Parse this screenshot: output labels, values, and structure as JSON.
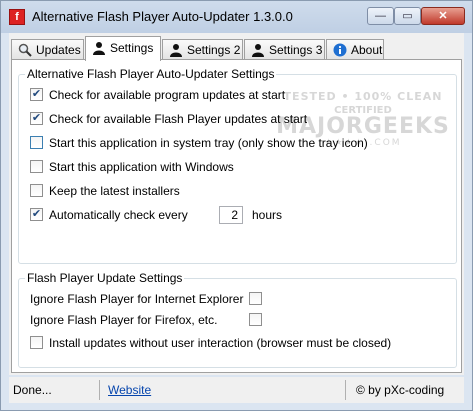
{
  "window": {
    "title": "Alternative Flash Player Auto-Updater 1.3.0.0",
    "icon": "flash-app-icon"
  },
  "caption_buttons": {
    "minimize": "—",
    "maximize": "▭",
    "close": "✕"
  },
  "tabs": [
    {
      "label": "Updates",
      "icon": "magnifier-icon"
    },
    {
      "label": "Settings",
      "icon": "person-icon"
    },
    {
      "label": "Settings 2",
      "icon": "person-icon"
    },
    {
      "label": "Settings 3",
      "icon": "person-icon"
    },
    {
      "label": "About",
      "icon": "info-icon"
    }
  ],
  "active_tab": "Settings",
  "watermark": {
    "line1": "TESTED • 100% CLEAN",
    "line2": "CERTIFIED",
    "line3": "MAJORGEEKS",
    "line4": "★★★★ .COM"
  },
  "group_updater": {
    "title": "Alternative Flash Player Auto-Updater Settings",
    "options": [
      {
        "label": "Check for available program updates at start",
        "checked": true
      },
      {
        "label": "Check for available Flash Player updates at start",
        "checked": true
      },
      {
        "label": "Start this application in system tray (only show the tray icon)",
        "checked": false
      },
      {
        "label": "Start this application with Windows",
        "checked": false
      },
      {
        "label": "Keep the latest installers",
        "checked": false
      },
      {
        "label": "Automatically check every",
        "checked": true
      }
    ],
    "interval_value": "2",
    "interval_unit": "hours"
  },
  "group_flash": {
    "title": "Flash Player Update Settings",
    "options": [
      {
        "label": "Ignore Flash Player for Internet Explorer",
        "checked": false
      },
      {
        "label": "Ignore Flash Player for Firefox, etc.",
        "checked": false
      },
      {
        "label": "Install updates without user interaction (browser must be closed)",
        "checked": false
      }
    ]
  },
  "statusbar": {
    "status": "Done...",
    "link": "Website",
    "copyright": "© by pXc-coding"
  },
  "colors": {
    "link": "#0645ad",
    "check": "#21497d",
    "close_button": "#c0392b"
  }
}
